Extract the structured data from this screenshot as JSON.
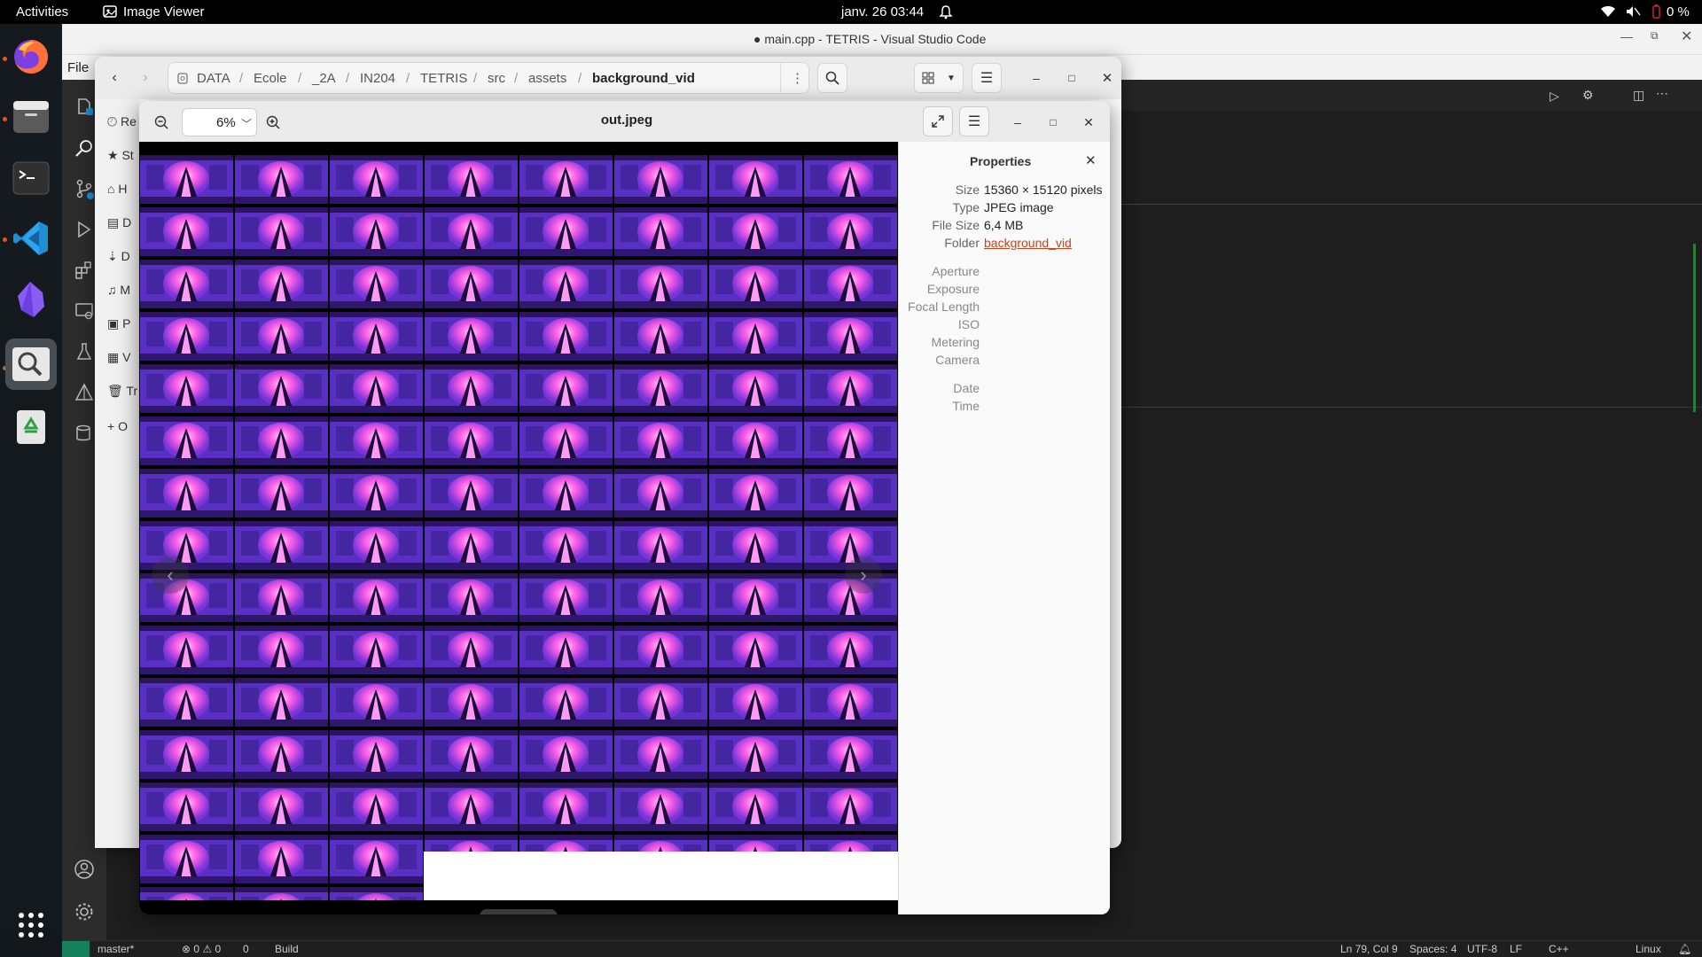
{
  "topbar": {
    "activities": "Activities",
    "app_name": "Image Viewer",
    "clock": "janv. 26  03:44",
    "battery": "0 %"
  },
  "dock": {
    "apps": [
      "firefox-icon",
      "files-icon",
      "terminal-icon",
      "vscode-icon",
      "obsidian-icon",
      "image-viewer-icon",
      "trash-icon",
      "show-apps-icon"
    ]
  },
  "vscode": {
    "title": "● main.cpp - TETRIS - Visual Studio Code",
    "menu_file": "File",
    "status": {
      "branch": "master*",
      "problems": "⊗ 0 ⚠ 0",
      "ports": "0",
      "build": "Build",
      "cursor": "Ln 79, Col 9",
      "spaces": "Spaces: 4",
      "encoding": "UTF-8",
      "eol": "LF",
      "language": "C++",
      "platform": "Linux"
    }
  },
  "files": {
    "path": [
      "DATA",
      "Ecole",
      "_2A",
      "IN204",
      "TETRIS",
      "src",
      "assets",
      "background_vid"
    ],
    "side_items": [
      "Re",
      "St",
      "H",
      "D",
      "D",
      "M",
      "P",
      "V",
      "Tr",
      "O"
    ]
  },
  "viewer": {
    "title": "out.jpeg",
    "zoom": "6%",
    "properties_title": "Properties",
    "properties": [
      {
        "label": "Size",
        "value": "15360 × 15120 pixels"
      },
      {
        "label": "Type",
        "value": "JPEG image"
      },
      {
        "label": "File Size",
        "value": "6,4 MB"
      },
      {
        "label": "Folder",
        "value": "background_vid"
      }
    ],
    "exif_labels": [
      "Aperture",
      "Exposure",
      "Focal Length",
      "ISO",
      "Metering",
      "Camera"
    ],
    "date_labels": [
      "Date",
      "Time"
    ]
  },
  "colors": {
    "accent": "#e95420",
    "thumb_bg": "#5a2fc4",
    "thumb_glow": "#ff6cf0",
    "link": "#c7431b"
  }
}
